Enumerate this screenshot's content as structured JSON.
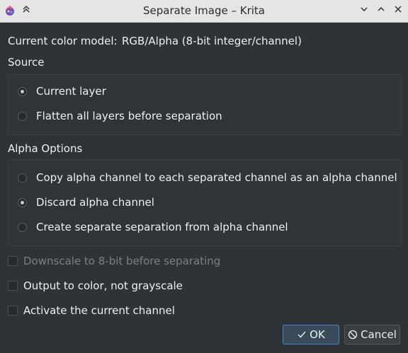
{
  "window": {
    "title": "Separate Image – Krita",
    "controls": {
      "minimize": "⌄",
      "maximize": "⌃",
      "close": "✕",
      "keep_above": "⌃"
    }
  },
  "color_model": {
    "label": "Current color model:",
    "value": "RGB/Alpha (8-bit integer/channel)"
  },
  "source": {
    "heading": "Source",
    "options": [
      {
        "label": "Current layer",
        "checked": true
      },
      {
        "label": "Flatten all layers before separation",
        "checked": false
      }
    ]
  },
  "alpha_options": {
    "heading": "Alpha Options",
    "options": [
      {
        "label": "Copy alpha channel to each separated channel as an alpha channel",
        "checked": false
      },
      {
        "label": "Discard alpha channel",
        "checked": true
      },
      {
        "label": "Create separate separation from alpha channel",
        "checked": false
      }
    ]
  },
  "checkboxes": [
    {
      "label": "Downscale to 8-bit before separating",
      "checked": false,
      "enabled": false
    },
    {
      "label": "Output to color, not grayscale",
      "checked": false,
      "enabled": true
    },
    {
      "label": "Activate the current channel",
      "checked": false,
      "enabled": true
    }
  ],
  "buttons": {
    "ok": "OK",
    "cancel": "Cancel"
  },
  "colors": {
    "background": "#2f3236",
    "titlebar": "#e5e5e5",
    "accent": "#3f88c5"
  }
}
